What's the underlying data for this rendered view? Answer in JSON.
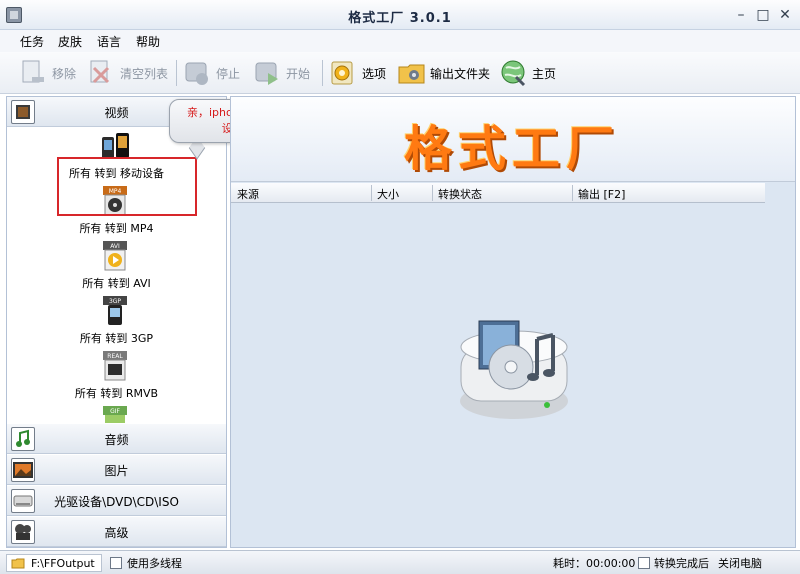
{
  "window": {
    "title": "格式工厂  3.0.1"
  },
  "menu": [
    "任务",
    "皮肤",
    "语言",
    "帮助"
  ],
  "toolbar": {
    "remove": "移除",
    "clear": "清空列表",
    "stop": "停止",
    "start": "开始",
    "options": "选项",
    "output_folder": "输出文件夹",
    "home": "主页"
  },
  "sidebar": {
    "categories": [
      "视频",
      "音频",
      "图片",
      "光驱设备\\DVD\\CD\\ISO",
      "高级"
    ],
    "video_items": [
      "所有 转到 移动设备",
      "所有 转到 MP4",
      "所有 转到 AVI",
      "所有 转到 3GP",
      "所有 转到 RMVB"
    ],
    "video_badges": [
      "MP4",
      "AVI",
      "3GP",
      "REAL",
      "GIF"
    ]
  },
  "callout": {
    "line1": "亲，iphone 是移动",
    "line2": "设备!"
  },
  "main": {
    "logo": "格式工厂",
    "columns": [
      "来源",
      "大小",
      "转换状态",
      "输出 [F2]"
    ]
  },
  "status": {
    "output_path": "F:\\FFOutput",
    "multithread": "使用多线程",
    "elapsed_label": "耗时：00:00:00",
    "after_done": "转换完成后",
    "shutdown": "关闭电脑"
  },
  "colors": {
    "highlight": "#d7262a",
    "callout_text": "#d61a1a",
    "logo": "#ff7a12"
  }
}
